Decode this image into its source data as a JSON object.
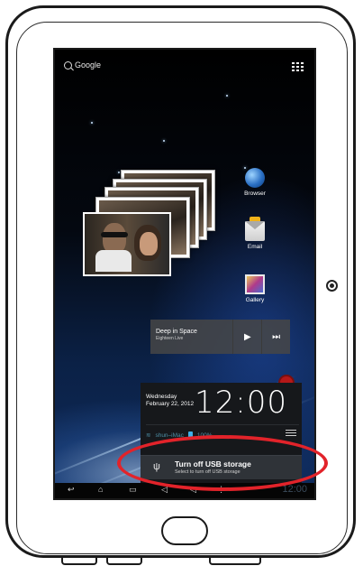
{
  "device": {
    "frame_icons": [
      "home-button",
      "front-camera"
    ]
  },
  "home": {
    "search_label": "Google",
    "apps_icon": "all-apps-grid-icon"
  },
  "shortcuts": [
    {
      "label": "Browser",
      "icon": "globe-icon"
    },
    {
      "label": "Email",
      "icon": "envelope-icon"
    },
    {
      "label": "Gallery",
      "icon": "gallery-icon"
    }
  ],
  "music_widget": {
    "title": "Deep in Space",
    "artist": "Eighteen Live",
    "play_icon": "▶",
    "next_icon": "⏭"
  },
  "notification_panel": {
    "weekday": "Wednesday",
    "date": "February 22, 2012",
    "time": "12:00",
    "wifi_name": "shun–iMac",
    "battery": "100%",
    "notification": {
      "title": "Turn off USB storage",
      "subtitle": "Select to turn off USB storage",
      "icon": "usb-icon"
    }
  },
  "navbar": {
    "back": "↩",
    "home": "⌂",
    "recent": "▭",
    "clock": "12:00"
  },
  "colors": {
    "highlight": "#e2232a",
    "accent": "#3fb0e8"
  }
}
